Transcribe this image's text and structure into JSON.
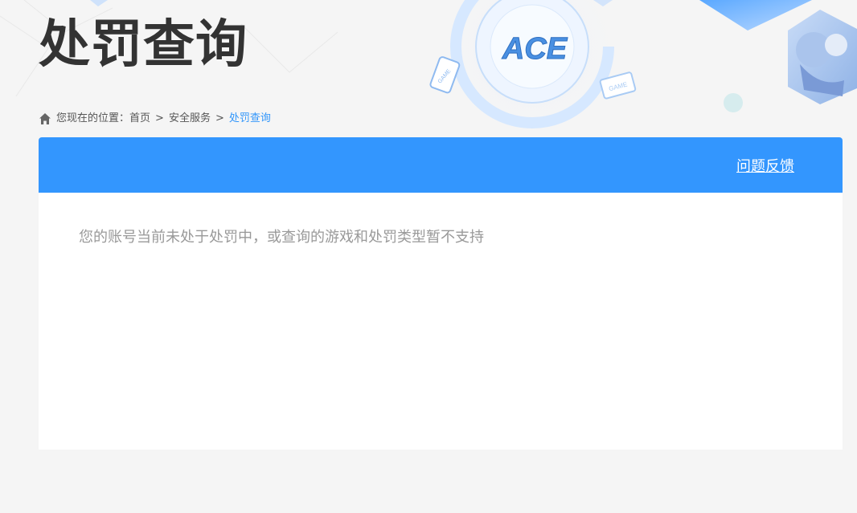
{
  "header": {
    "title": "处罚查询",
    "logo_text": "ACE",
    "deco_tag_a": "GAME",
    "deco_tag_b": "GAME"
  },
  "breadcrumb": {
    "prefix": "您现在的位置：",
    "items": [
      "首页",
      "安全服务",
      "处罚查询"
    ],
    "separator": ">"
  },
  "panel": {
    "feedback_label": "问题反馈",
    "message": "您的账号当前未处于处罚中，或查询的游戏和处罚类型暂不支持"
  },
  "colors": {
    "accent": "#3396fe",
    "title": "#333333",
    "breadcrumb_current": "#3296fa",
    "message": "#999999",
    "background": "#f5f5f5"
  },
  "icons": {
    "breadcrumb_home": "home-icon"
  }
}
